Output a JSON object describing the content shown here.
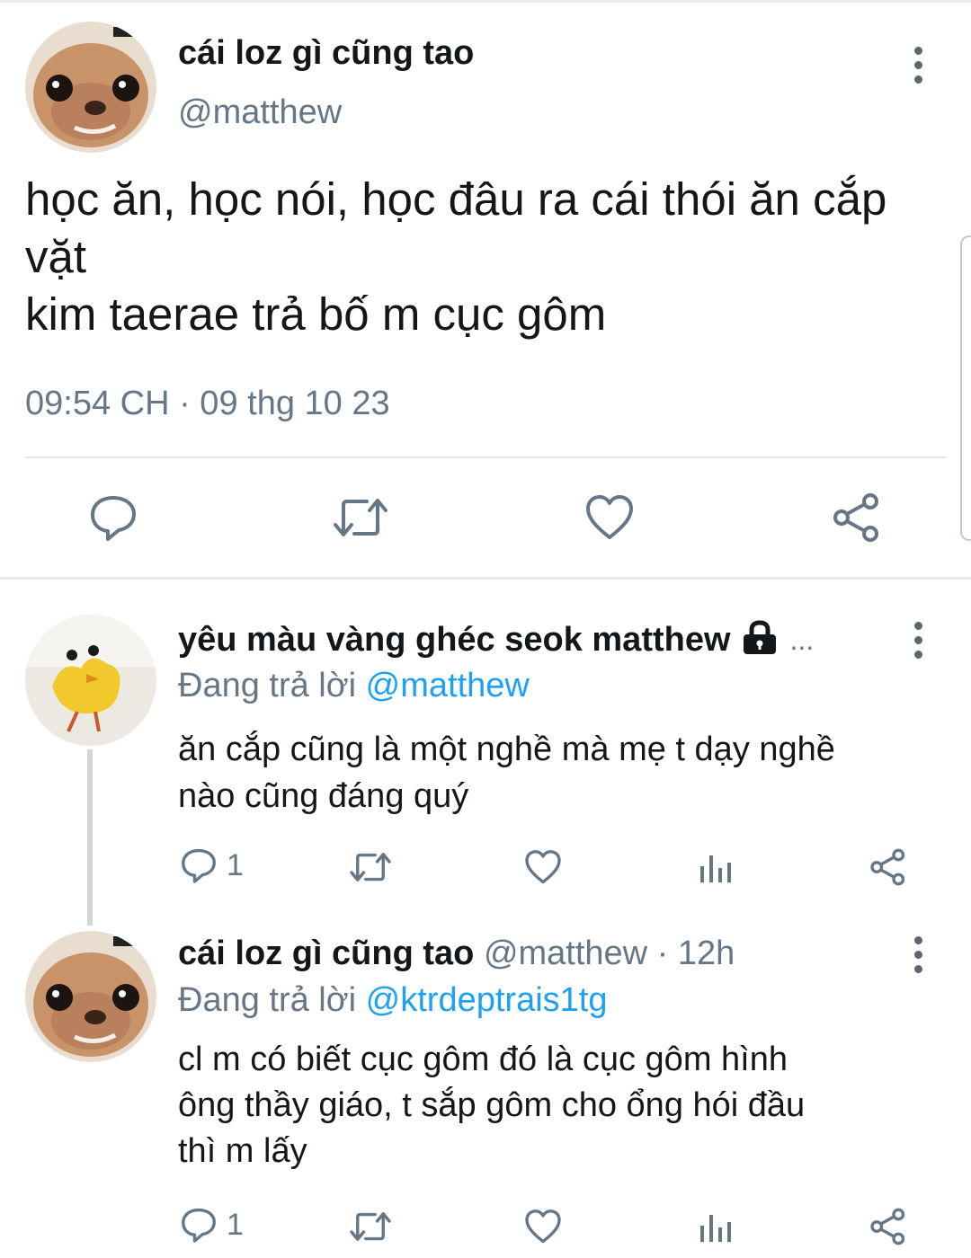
{
  "main_tweet": {
    "display_name": "cái loz gì cũng tao",
    "handle": "@matthew",
    "text_line1": "học ăn, học nói, học đâu ra cái thói ăn cắp",
    "text_line2": "vặt",
    "text_line3": "kim taerae trả bố m cục gôm",
    "timestamp": "09:54 CH · 09 thg 10 23",
    "avatar_icon": "chihuahua-avatar",
    "actions": [
      "reply-icon",
      "retweet-icon",
      "like-icon",
      "share-icon"
    ]
  },
  "replies": [
    {
      "display_name": "yêu màu vàng ghéc seok matthew",
      "ellipsis": "...",
      "protected_icon": "lock-icon",
      "replying_prefix": "Đang trả lời",
      "replying_to": "@matthew",
      "text_line1": "ăn cắp cũng là một nghề mà mẹ t dạy nghề",
      "text_line2": "nào cũng đáng quý",
      "reply_count": "1",
      "avatar_icon": "yellow-chick-avatar"
    },
    {
      "display_name": "cái loz gì cũng tao",
      "handle_time": "@matthew · 12h",
      "replying_prefix": "Đang trả lời",
      "replying_to": "@ktrdeptrais1tg",
      "text_line1": "cl m có biết cục gôm đó là cục gôm hình",
      "text_line2": "ông thầy giáo, t sắp gôm cho ổng hói đầu",
      "text_line3": "thì m lấy",
      "reply_count": "1",
      "avatar_icon": "chihuahua-avatar"
    }
  ],
  "colors": {
    "text": "#14171a",
    "muted": "#657786",
    "link": "#1da1f2",
    "divider": "#e1e8ed",
    "thread_line": "#d0d6dc",
    "icon": "#657786"
  }
}
